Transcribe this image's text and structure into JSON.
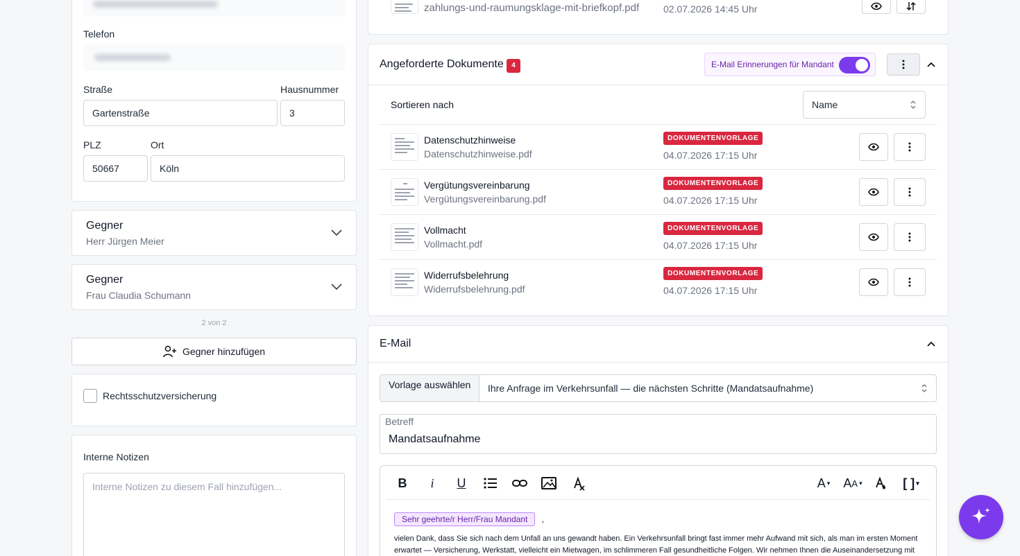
{
  "left": {
    "phone_label": "Telefon",
    "street_label": "Straße",
    "street_value": "Gartenstraße",
    "housenr_label": "Hausnummer",
    "housenr_value": "3",
    "plz_label": "PLZ",
    "plz_value": "50667",
    "ort_label": "Ort",
    "ort_value": "Köln",
    "opponents": [
      {
        "title": "Gegner",
        "name": "Herr Jürgen Meier"
      },
      {
        "title": "Gegner",
        "name": "Frau Claudia Schumann"
      }
    ],
    "pagination": "2 von 2",
    "add_opponent_label": "Gegner hinzufügen",
    "legal_insurance_label": "Rechtsschutzversicherung",
    "notes_label": "Interne Notizen",
    "notes_placeholder": "Interne Notizen zu diesem Fall hinzufügen..."
  },
  "top_doc": {
    "file": "zahlungs-und-raumungsklage-mit-briefkopf.pdf",
    "date": "02.07.2026 14:45 Uhr"
  },
  "requested": {
    "title": "Angeforderte Dokumente",
    "count": "4",
    "reminder_label": "E-Mail Erinnerungen für Mandant",
    "reminder_on": true,
    "sort_label": "Sortieren nach",
    "sort_value": "Name",
    "docs": [
      {
        "name": "Datenschutzhinweise",
        "file": "Datenschutzhinweise.pdf",
        "badge": "DOKUMENTENVORLAGE",
        "date": "04.07.2026 17:15 Uhr"
      },
      {
        "name": "Vergütungsvereinbarung",
        "file": "Vergütungsvereinbarung.pdf",
        "badge": "DOKUMENTENVORLAGE",
        "date": "04.07.2026 17:15 Uhr"
      },
      {
        "name": "Vollmacht",
        "file": "Vollmacht.pdf",
        "badge": "DOKUMENTENVORLAGE",
        "date": "04.07.2026 17:15 Uhr"
      },
      {
        "name": "Widerrufsbelehrung",
        "file": "Widerrufsbelehrung.pdf",
        "badge": "DOKUMENTENVORLAGE",
        "date": "04.07.2026 17:15 Uhr"
      }
    ]
  },
  "email": {
    "title": "E-Mail",
    "template_label": "Vorlage auswählen",
    "template_value": "Ihre Anfrage im Verkehrsunfall — die nächsten Schritte (Mandatsaufnahme)",
    "subject_label": "Betreff",
    "subject_value": "Mandatsaufnahme",
    "placeholder_chip": "Sehr geehrte/r Herr/Frau Mandant",
    "greeting_suffix": ",",
    "body_text": "vielen Dank, dass Sie sich nach dem Unfall an uns gewandt haben. Ein Verkehrsunfall bringt fast immer mehr Aufwand mit sich, als man im ersten Moment erwartet — Versicherung, Werkstatt, vielleicht ein Mietwagen, im schlimmeren Fall gesundheitliche Folgen. Wir nehmen Ihnen die Auseinandersetzung mit"
  },
  "colors": {
    "accent": "#7c3aed",
    "badge_red": "#d9273f",
    "chip_bg": "#f3e8ff"
  }
}
